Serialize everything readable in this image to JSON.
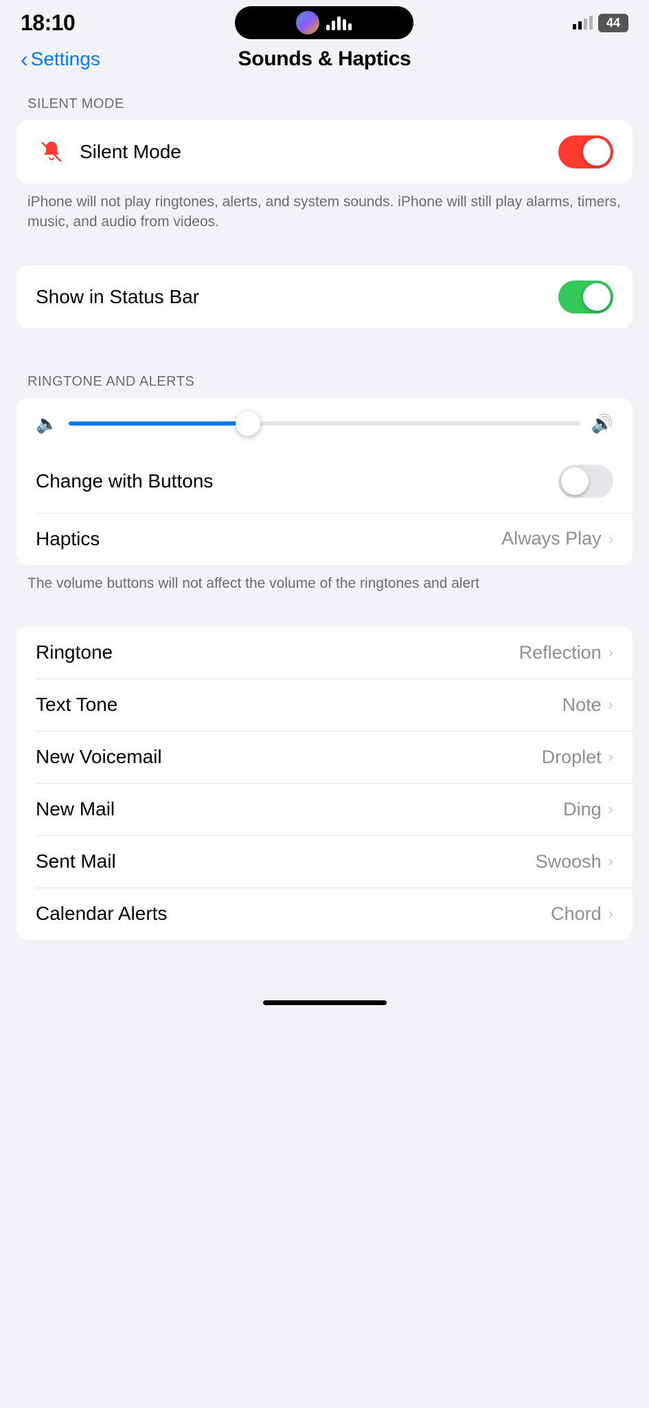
{
  "statusBar": {
    "time": "18:10",
    "battery": "44",
    "signal_bars": [
      true,
      true,
      false,
      false
    ]
  },
  "nav": {
    "back_label": "Settings",
    "title": "Sounds & Haptics"
  },
  "sections": {
    "silentMode": {
      "header": "SILENT MODE",
      "row_label": "Silent Mode",
      "toggle_state": "on",
      "footer": "iPhone will not play ringtones, alerts, and system sounds. iPhone will still play alarms, timers, music, and audio from videos."
    },
    "statusBar": {
      "row_label": "Show in Status Bar",
      "toggle_state": "green"
    },
    "ringtoneAlerts": {
      "header": "RINGTONE AND ALERTS",
      "slider_percent": 35,
      "change_with_buttons_label": "Change with Buttons",
      "change_with_buttons_state": "off",
      "haptics_label": "Haptics",
      "haptics_value": "Always Play",
      "footer": "The volume buttons will not affect the volume of the ringtones and alert"
    },
    "tones": {
      "items": [
        {
          "label": "Ringtone",
          "value": "Reflection"
        },
        {
          "label": "Text Tone",
          "value": "Note"
        },
        {
          "label": "New Voicemail",
          "value": "Droplet"
        },
        {
          "label": "New Mail",
          "value": "Ding"
        },
        {
          "label": "Sent Mail",
          "value": "Swoosh"
        },
        {
          "label": "Calendar Alerts",
          "value": "Chord"
        }
      ]
    }
  }
}
